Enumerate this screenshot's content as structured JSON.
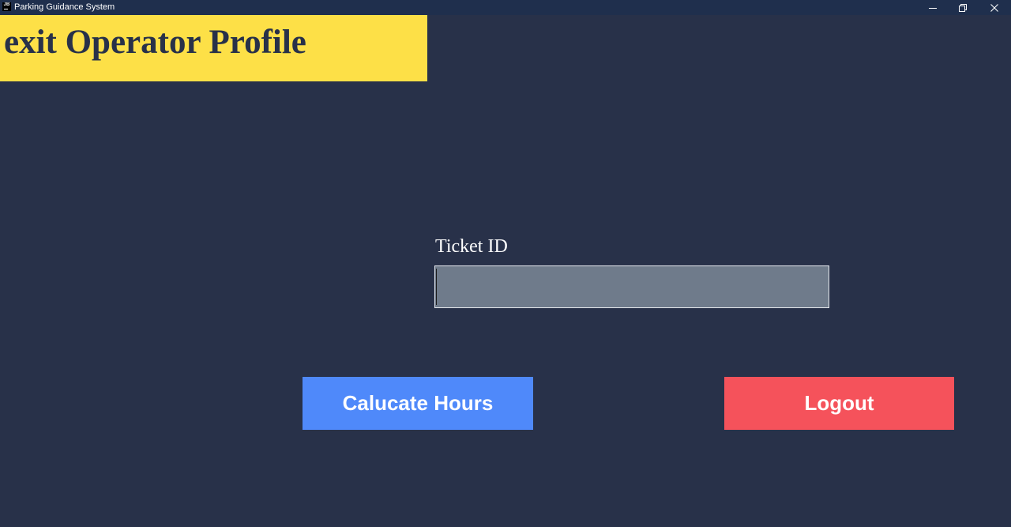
{
  "window": {
    "title": "Parking Guidance System",
    "icon_text": "JB",
    "controls": {
      "minimize": "minimize-icon",
      "maximize": "restore-icon",
      "close": "close-icon"
    }
  },
  "header": {
    "title": "exit Operator Profile"
  },
  "form": {
    "ticket_label": "Ticket ID",
    "ticket_value": "",
    "ticket_placeholder": ""
  },
  "actions": {
    "calculate_label": "Calucate Hours",
    "logout_label": "Logout"
  },
  "colors": {
    "background": "#283149",
    "titlebar": "#1f2f4d",
    "banner": "#fde047",
    "input_bg": "#6f7b8b",
    "calculate_bg": "#4f89fa",
    "logout_bg": "#f5525b"
  }
}
